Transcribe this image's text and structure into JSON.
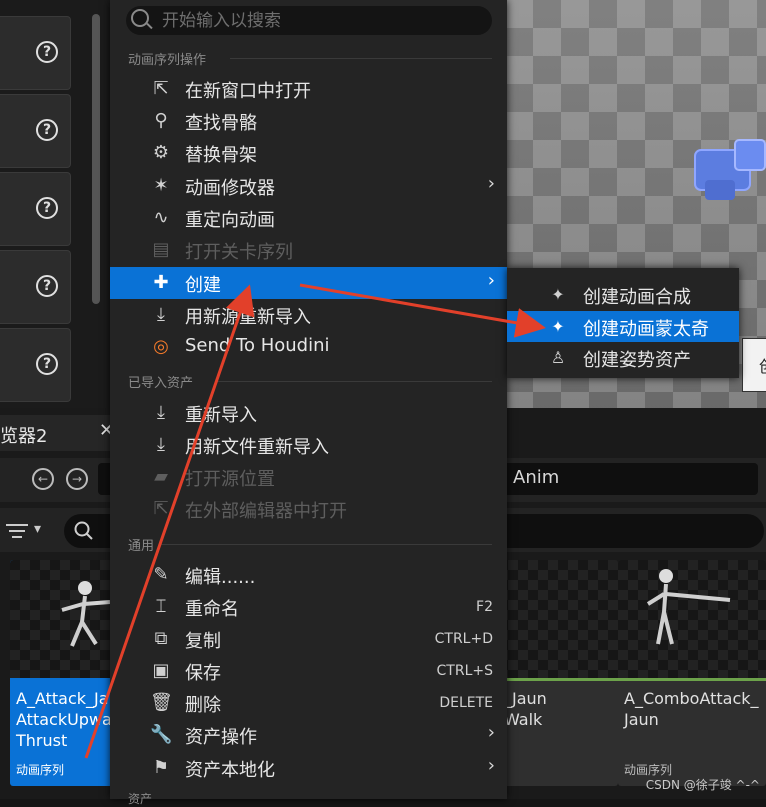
{
  "colors": {
    "accent": "#0a72d6",
    "menu_bg": "#242424",
    "arrow": "#e2402a",
    "asset_type_bar": "#6ca24a"
  },
  "menu": {
    "search_placeholder": "开始输入以搜索",
    "sections": {
      "anim_sequence_actions": "动画序列操作",
      "imported_assets": "已导入资产",
      "common": "通用",
      "more_hint": "资产"
    },
    "items": [
      {
        "label": "在新窗口中打开",
        "icon": "open-window-icon"
      },
      {
        "label": "查找骨骼",
        "icon": "find-skeleton-icon"
      },
      {
        "label": "替换骨架",
        "icon": "replace-skeleton-icon"
      },
      {
        "label": "动画修改器",
        "icon": "anim-modifier-icon",
        "submenu": true
      },
      {
        "label": "重定向动画",
        "icon": "retarget-icon"
      },
      {
        "label": "打开关卡序列",
        "icon": "level-sequence-icon",
        "disabled": true
      },
      {
        "label": "创建",
        "icon": "create-icon",
        "submenu": true,
        "highlighted": true
      },
      {
        "label": "用新源重新导入",
        "icon": "reimport-new-source-icon"
      },
      {
        "label": "Send To Houdini",
        "icon": "houdini-icon"
      },
      {
        "label": "重新导入",
        "icon": "reimport-icon"
      },
      {
        "label": "用新文件重新导入",
        "icon": "reimport-new-file-icon"
      },
      {
        "label": "打开源位置",
        "icon": "folder-icon",
        "disabled": true
      },
      {
        "label": "在外部编辑器中打开",
        "icon": "external-editor-icon",
        "disabled": true
      },
      {
        "label": "编辑......",
        "icon": "edit-icon"
      },
      {
        "label": "重命名",
        "icon": "rename-icon",
        "shortcut": "F2"
      },
      {
        "label": "复制",
        "icon": "duplicate-icon",
        "shortcut": "CTRL+D"
      },
      {
        "label": "保存",
        "icon": "save-icon",
        "shortcut": "CTRL+S"
      },
      {
        "label": "删除",
        "icon": "delete-icon",
        "shortcut": "DELETE"
      },
      {
        "label": "资产操作",
        "icon": "asset-actions-icon",
        "submenu": true
      },
      {
        "label": "资产本地化",
        "icon": "localization-icon",
        "submenu": true
      }
    ]
  },
  "submenu": {
    "items": [
      {
        "label": "创建动画合成",
        "icon": "anim-composite-icon"
      },
      {
        "label": "创建动画蒙太奇",
        "icon": "anim-montage-icon",
        "highlighted": true
      },
      {
        "label": "创建姿势资产",
        "icon": "pose-asset-icon"
      }
    ]
  },
  "content_browser": {
    "tab_label": "览器2",
    "path_text": "Anim",
    "assets": [
      {
        "name": "A_Attack_Ja\nAttackUpwa\nThrust",
        "type": "动画序列",
        "selected": true
      },
      {
        "name": "_Jaun\nWalk",
        "type": ""
      },
      {
        "name": "A_ComboAttack_\nJaun",
        "type": "动画序列"
      }
    ]
  },
  "tooltip": {
    "text": "创"
  },
  "watermark": "CSDN @徐子竣 ^-^"
}
